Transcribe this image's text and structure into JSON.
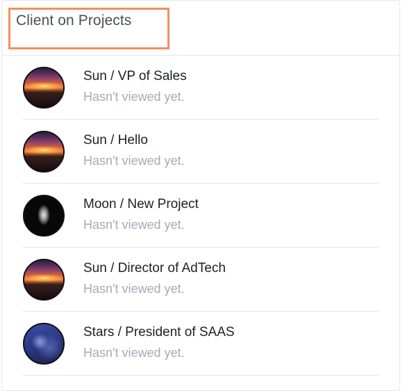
{
  "header": {
    "title": "Client on Projects"
  },
  "items": [
    {
      "name": "Sun / VP of Sales",
      "status": "Hasn't viewed yet.",
      "avatar": "sunset-avatar"
    },
    {
      "name": "Sun / Hello",
      "status": "Hasn't viewed yet.",
      "avatar": "sunset-avatar"
    },
    {
      "name": "Moon / New Project",
      "status": "Hasn't viewed yet.",
      "avatar": "moon-avatar"
    },
    {
      "name": "Sun / Director of AdTech",
      "status": "Hasn't viewed yet.",
      "avatar": "sunset-avatar"
    },
    {
      "name": "Stars / President of SAAS",
      "status": "Hasn't viewed yet.",
      "avatar": "stars-avatar"
    }
  ],
  "colors": {
    "highlight_border": "#f0905a",
    "title_text": "#4a4f57",
    "name_text": "#1d1f23",
    "status_text": "#a3acb6",
    "divider": "#e3e6ea"
  }
}
